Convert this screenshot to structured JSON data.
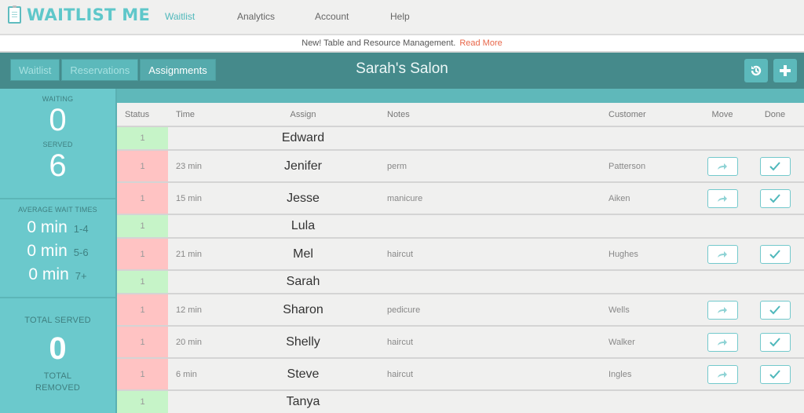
{
  "app": {
    "logo_text": "WAITLIST ME"
  },
  "nav": {
    "items": [
      {
        "label": "Waitlist",
        "active": true
      },
      {
        "label": "Analytics",
        "active": false
      },
      {
        "label": "Account",
        "active": false
      },
      {
        "label": "Help",
        "active": false
      }
    ]
  },
  "announcement": {
    "text": "New! Table and Resource Management.",
    "link": "Read More"
  },
  "toolbar": {
    "tabs": [
      {
        "label": "Waitlist",
        "active": false
      },
      {
        "label": "Reservations",
        "active": false
      },
      {
        "label": "Assignments",
        "active": true
      }
    ],
    "title": "Sarah's Salon",
    "history_icon": "history-icon",
    "add_icon": "plus-icon"
  },
  "sidebar": {
    "waiting_label": "WAITING",
    "waiting_value": "0",
    "served_label": "SERVED",
    "served_value": "6",
    "avg_label": "AVERAGE WAIT TIMES",
    "avg_rows": [
      {
        "value": "0 min",
        "range": "1-4"
      },
      {
        "value": "0 min",
        "range": "5-6"
      },
      {
        "value": "0 min",
        "range": "7+"
      }
    ],
    "total_served_label": "TOTAL SERVED",
    "total_served_value": "0",
    "total_removed_label": "TOTAL REMOVED"
  },
  "table": {
    "headers": {
      "status": "Status",
      "time": "Time",
      "assign": "Assign",
      "notes": "Notes",
      "customer": "Customer",
      "move": "Move",
      "done": "Done"
    },
    "rows": [
      {
        "status": "1",
        "state": "free",
        "time": "",
        "assign": "Edward",
        "notes": "",
        "customer": ""
      },
      {
        "status": "1",
        "state": "busy",
        "time": "23 min",
        "assign": "Jenifer",
        "notes": "perm",
        "customer": "Patterson"
      },
      {
        "status": "1",
        "state": "busy",
        "time": "15 min",
        "assign": "Jesse",
        "notes": "manicure",
        "customer": "Aiken"
      },
      {
        "status": "1",
        "state": "free",
        "time": "",
        "assign": "Lula",
        "notes": "",
        "customer": ""
      },
      {
        "status": "1",
        "state": "busy",
        "time": "21 min",
        "assign": "Mel",
        "notes": "haircut",
        "customer": "Hughes"
      },
      {
        "status": "1",
        "state": "free",
        "time": "",
        "assign": "Sarah",
        "notes": "",
        "customer": ""
      },
      {
        "status": "1",
        "state": "busy",
        "time": "12 min",
        "assign": "Sharon",
        "notes": "pedicure",
        "customer": "Wells"
      },
      {
        "status": "1",
        "state": "busy",
        "time": "20 min",
        "assign": "Shelly",
        "notes": "haircut",
        "customer": "Walker"
      },
      {
        "status": "1",
        "state": "busy",
        "time": "6 min",
        "assign": "Steve",
        "notes": "haircut",
        "customer": "Ingles"
      },
      {
        "status": "1",
        "state": "free",
        "time": "",
        "assign": "Tanya",
        "notes": "",
        "customer": ""
      }
    ],
    "move_icon": "share-arrow-icon",
    "done_icon": "checkmark-icon"
  },
  "colors": {
    "brand": "#5fc7ca",
    "toolbar": "#458a8b",
    "sidebar": "#6bc9cc",
    "status_free": "#c6f4c8",
    "status_busy": "#ffc3c3",
    "link": "#e8674a"
  }
}
